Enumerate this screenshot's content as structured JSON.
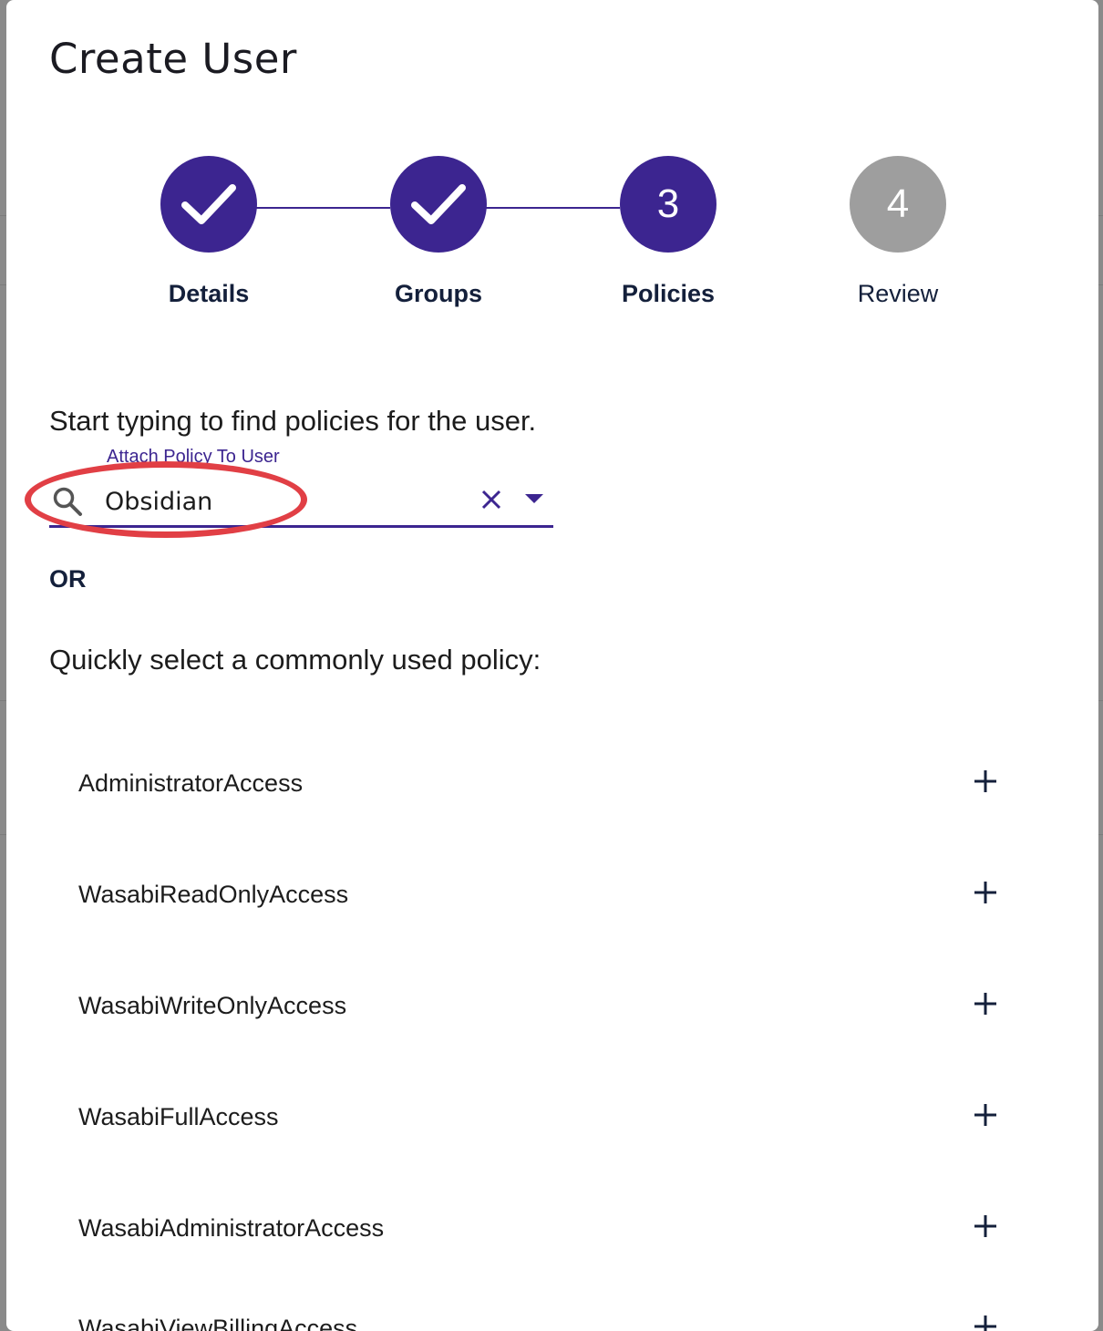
{
  "dialog": {
    "title": "Create User"
  },
  "stepper": {
    "steps": [
      {
        "label": "Details",
        "state": "completed",
        "number": "1"
      },
      {
        "label": "Groups",
        "state": "completed",
        "number": "2"
      },
      {
        "label": "Policies",
        "state": "active",
        "number": "3"
      },
      {
        "label": "Review",
        "state": "pending",
        "number": "4"
      }
    ]
  },
  "policy_search": {
    "prompt": "Start typing to find policies for the user.",
    "field_label": "Attach Policy To User",
    "value": "Obsidian",
    "annotation_color": "#e13f45"
  },
  "divider_text": "OR",
  "common_policies": {
    "heading": "Quickly select a commonly used policy:",
    "items": [
      "AdministratorAccess",
      "WasabiReadOnlyAccess",
      "WasabiWriteOnlyAccess",
      "WasabiFullAccess",
      "WasabiAdministratorAccess",
      "WasabiViewBillingAccess"
    ]
  },
  "colors": {
    "primary": "#3c2590",
    "pending": "#9e9e9e",
    "text": "#1c1c1c"
  }
}
